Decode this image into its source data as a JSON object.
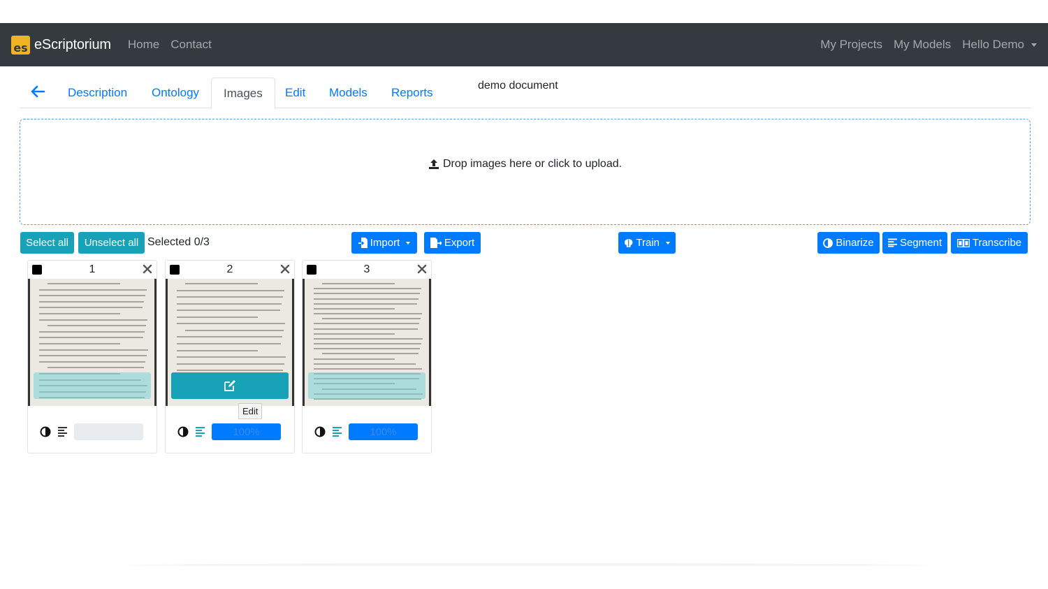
{
  "navbar": {
    "brand": "eScriptorium",
    "logo_text": "es",
    "links": [
      "Home",
      "Contact"
    ],
    "right_links": [
      "My Projects",
      "My Models"
    ],
    "user_menu": "Hello Demo"
  },
  "tabs": {
    "items": [
      "Description",
      "Ontology",
      "Images",
      "Edit",
      "Models",
      "Reports"
    ],
    "active": "Images"
  },
  "document_title": "demo document",
  "dropzone": {
    "text": "Drop images here or click to upload."
  },
  "toolbar": {
    "select_all": "Select all",
    "unselect_all": "Unselect all",
    "selected": "Selected 0/3",
    "import": "Import",
    "export": "Export",
    "train": "Train",
    "binarize": "Binarize",
    "segment": "Segment",
    "transcribe": "Transcribe"
  },
  "cards": [
    {
      "number": "1",
      "progress_label": "",
      "progress": 0
    },
    {
      "number": "2",
      "progress_label": "100%",
      "progress": 100
    },
    {
      "number": "3",
      "progress_label": "100%",
      "progress": 100
    }
  ],
  "tooltip": "Edit",
  "colors": {
    "navbar": "#343a40",
    "primary": "#007bff",
    "info": "#17a2b8",
    "logo": "#f0b323"
  }
}
